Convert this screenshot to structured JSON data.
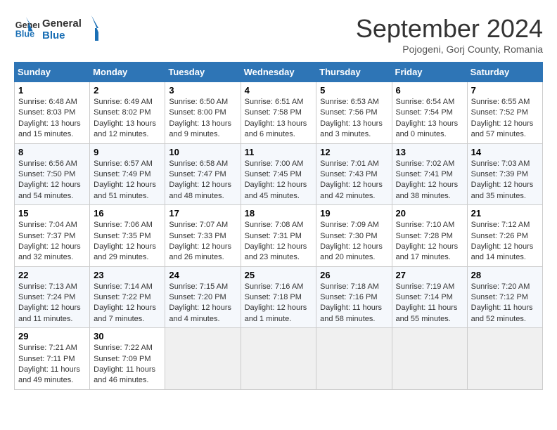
{
  "header": {
    "logo_line1": "General",
    "logo_line2": "Blue",
    "title": "September 2024",
    "subtitle": "Pojogeni, Gorj County, Romania"
  },
  "columns": [
    "Sunday",
    "Monday",
    "Tuesday",
    "Wednesday",
    "Thursday",
    "Friday",
    "Saturday"
  ],
  "weeks": [
    [
      {
        "day": "1",
        "sunrise": "Sunrise: 6:48 AM",
        "sunset": "Sunset: 8:03 PM",
        "daylight": "Daylight: 13 hours and 15 minutes."
      },
      {
        "day": "2",
        "sunrise": "Sunrise: 6:49 AM",
        "sunset": "Sunset: 8:02 PM",
        "daylight": "Daylight: 13 hours and 12 minutes."
      },
      {
        "day": "3",
        "sunrise": "Sunrise: 6:50 AM",
        "sunset": "Sunset: 8:00 PM",
        "daylight": "Daylight: 13 hours and 9 minutes."
      },
      {
        "day": "4",
        "sunrise": "Sunrise: 6:51 AM",
        "sunset": "Sunset: 7:58 PM",
        "daylight": "Daylight: 13 hours and 6 minutes."
      },
      {
        "day": "5",
        "sunrise": "Sunrise: 6:53 AM",
        "sunset": "Sunset: 7:56 PM",
        "daylight": "Daylight: 13 hours and 3 minutes."
      },
      {
        "day": "6",
        "sunrise": "Sunrise: 6:54 AM",
        "sunset": "Sunset: 7:54 PM",
        "daylight": "Daylight: 13 hours and 0 minutes."
      },
      {
        "day": "7",
        "sunrise": "Sunrise: 6:55 AM",
        "sunset": "Sunset: 7:52 PM",
        "daylight": "Daylight: 12 hours and 57 minutes."
      }
    ],
    [
      {
        "day": "8",
        "sunrise": "Sunrise: 6:56 AM",
        "sunset": "Sunset: 7:50 PM",
        "daylight": "Daylight: 12 hours and 54 minutes."
      },
      {
        "day": "9",
        "sunrise": "Sunrise: 6:57 AM",
        "sunset": "Sunset: 7:49 PM",
        "daylight": "Daylight: 12 hours and 51 minutes."
      },
      {
        "day": "10",
        "sunrise": "Sunrise: 6:58 AM",
        "sunset": "Sunset: 7:47 PM",
        "daylight": "Daylight: 12 hours and 48 minutes."
      },
      {
        "day": "11",
        "sunrise": "Sunrise: 7:00 AM",
        "sunset": "Sunset: 7:45 PM",
        "daylight": "Daylight: 12 hours and 45 minutes."
      },
      {
        "day": "12",
        "sunrise": "Sunrise: 7:01 AM",
        "sunset": "Sunset: 7:43 PM",
        "daylight": "Daylight: 12 hours and 42 minutes."
      },
      {
        "day": "13",
        "sunrise": "Sunrise: 7:02 AM",
        "sunset": "Sunset: 7:41 PM",
        "daylight": "Daylight: 12 hours and 38 minutes."
      },
      {
        "day": "14",
        "sunrise": "Sunrise: 7:03 AM",
        "sunset": "Sunset: 7:39 PM",
        "daylight": "Daylight: 12 hours and 35 minutes."
      }
    ],
    [
      {
        "day": "15",
        "sunrise": "Sunrise: 7:04 AM",
        "sunset": "Sunset: 7:37 PM",
        "daylight": "Daylight: 12 hours and 32 minutes."
      },
      {
        "day": "16",
        "sunrise": "Sunrise: 7:06 AM",
        "sunset": "Sunset: 7:35 PM",
        "daylight": "Daylight: 12 hours and 29 minutes."
      },
      {
        "day": "17",
        "sunrise": "Sunrise: 7:07 AM",
        "sunset": "Sunset: 7:33 PM",
        "daylight": "Daylight: 12 hours and 26 minutes."
      },
      {
        "day": "18",
        "sunrise": "Sunrise: 7:08 AM",
        "sunset": "Sunset: 7:31 PM",
        "daylight": "Daylight: 12 hours and 23 minutes."
      },
      {
        "day": "19",
        "sunrise": "Sunrise: 7:09 AM",
        "sunset": "Sunset: 7:30 PM",
        "daylight": "Daylight: 12 hours and 20 minutes."
      },
      {
        "day": "20",
        "sunrise": "Sunrise: 7:10 AM",
        "sunset": "Sunset: 7:28 PM",
        "daylight": "Daylight: 12 hours and 17 minutes."
      },
      {
        "day": "21",
        "sunrise": "Sunrise: 7:12 AM",
        "sunset": "Sunset: 7:26 PM",
        "daylight": "Daylight: 12 hours and 14 minutes."
      }
    ],
    [
      {
        "day": "22",
        "sunrise": "Sunrise: 7:13 AM",
        "sunset": "Sunset: 7:24 PM",
        "daylight": "Daylight: 12 hours and 11 minutes."
      },
      {
        "day": "23",
        "sunrise": "Sunrise: 7:14 AM",
        "sunset": "Sunset: 7:22 PM",
        "daylight": "Daylight: 12 hours and 7 minutes."
      },
      {
        "day": "24",
        "sunrise": "Sunrise: 7:15 AM",
        "sunset": "Sunset: 7:20 PM",
        "daylight": "Daylight: 12 hours and 4 minutes."
      },
      {
        "day": "25",
        "sunrise": "Sunrise: 7:16 AM",
        "sunset": "Sunset: 7:18 PM",
        "daylight": "Daylight: 12 hours and 1 minute."
      },
      {
        "day": "26",
        "sunrise": "Sunrise: 7:18 AM",
        "sunset": "Sunset: 7:16 PM",
        "daylight": "Daylight: 11 hours and 58 minutes."
      },
      {
        "day": "27",
        "sunrise": "Sunrise: 7:19 AM",
        "sunset": "Sunset: 7:14 PM",
        "daylight": "Daylight: 11 hours and 55 minutes."
      },
      {
        "day": "28",
        "sunrise": "Sunrise: 7:20 AM",
        "sunset": "Sunset: 7:12 PM",
        "daylight": "Daylight: 11 hours and 52 minutes."
      }
    ],
    [
      {
        "day": "29",
        "sunrise": "Sunrise: 7:21 AM",
        "sunset": "Sunset: 7:11 PM",
        "daylight": "Daylight: 11 hours and 49 minutes."
      },
      {
        "day": "30",
        "sunrise": "Sunrise: 7:22 AM",
        "sunset": "Sunset: 7:09 PM",
        "daylight": "Daylight: 11 hours and 46 minutes."
      },
      null,
      null,
      null,
      null,
      null
    ]
  ]
}
